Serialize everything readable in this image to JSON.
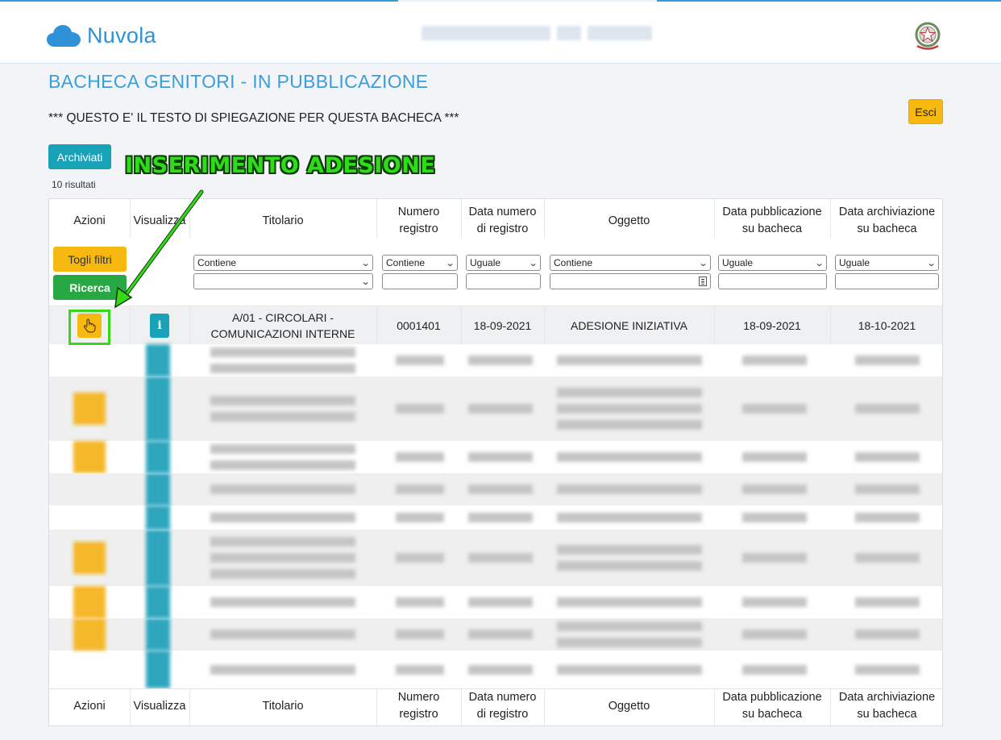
{
  "header": {
    "app_name": "Nuvola",
    "logo_icon": "cloud-icon",
    "emblem_icon": "italian-republic-emblem-icon",
    "brand_color": "#2f92d6"
  },
  "page": {
    "title": "BACHECA GENITORI - IN PUBBLICAZIONE",
    "explanation": "*** QUESTO E' IL TESTO DI SPIEGAZIONE PER QUESTA BACHECA ***",
    "exit_label": "Esci",
    "archived_label": "Archiviati",
    "results_count": "10 risultati"
  },
  "annotation": {
    "label": "INSERIMENTO ADESIONE",
    "color": "#37d81a"
  },
  "table": {
    "columns": [
      {
        "line1": "Azioni",
        "line2": ""
      },
      {
        "line1": "Visualizza",
        "line2": ""
      },
      {
        "line1": "Titolario",
        "line2": ""
      },
      {
        "line1": "Numero",
        "line2": "registro"
      },
      {
        "line1": "Data numero",
        "line2": "di registro"
      },
      {
        "line1": "Oggetto",
        "line2": ""
      },
      {
        "line1": "Data pubblicazione",
        "line2": "su bacheca"
      },
      {
        "line1": "Data archiviazione",
        "line2": "su bacheca"
      }
    ],
    "filters": {
      "clear_label": "Togli filtri",
      "search_label": "Ricerca",
      "titolario_mode": "Contiene",
      "numero_mode": "Contiene",
      "data_numero_mode": "Uguale",
      "oggetto_mode": "Contiene",
      "data_pubblicazione_mode": "Uguale",
      "data_archiviazione_mode": "Uguale"
    },
    "first_row": {
      "titolario_line1": "A/01 - CIRCOLARI -",
      "titolario_line2": "COMUNICAZIONI INTERNE",
      "numero_registro": "0001401",
      "data_numero": "18-09-2021",
      "oggetto": "ADESIONE INIZIATIVA",
      "data_pubblicazione": "18-09-2021",
      "data_archiviazione": "18-10-2021",
      "action_icon": "hand-pointer-icon",
      "view_icon": "info-icon",
      "view_glyph": "i"
    }
  }
}
